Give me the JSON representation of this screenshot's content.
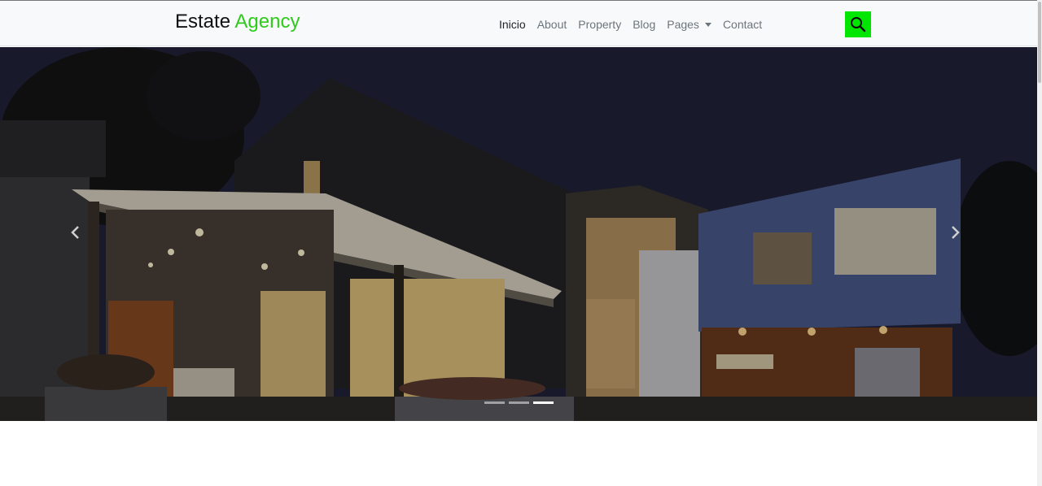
{
  "brand": {
    "name": "Estate",
    "accent": "Agency",
    "accent_color": "#2ecc1a"
  },
  "nav": {
    "items": [
      {
        "label": "Inicio"
      },
      {
        "label": "About"
      },
      {
        "label": "Property"
      },
      {
        "label": "Blog"
      },
      {
        "label": "Pages"
      },
      {
        "label": "Contact"
      }
    ]
  },
  "search": {
    "icon": "search-icon",
    "color": "#00e600"
  },
  "carousel": {
    "prev_icon": "chevron-left-icon",
    "next_icon": "chevron-right-icon",
    "slide_count": 3,
    "active_index": 2,
    "image": "modern house at night"
  }
}
